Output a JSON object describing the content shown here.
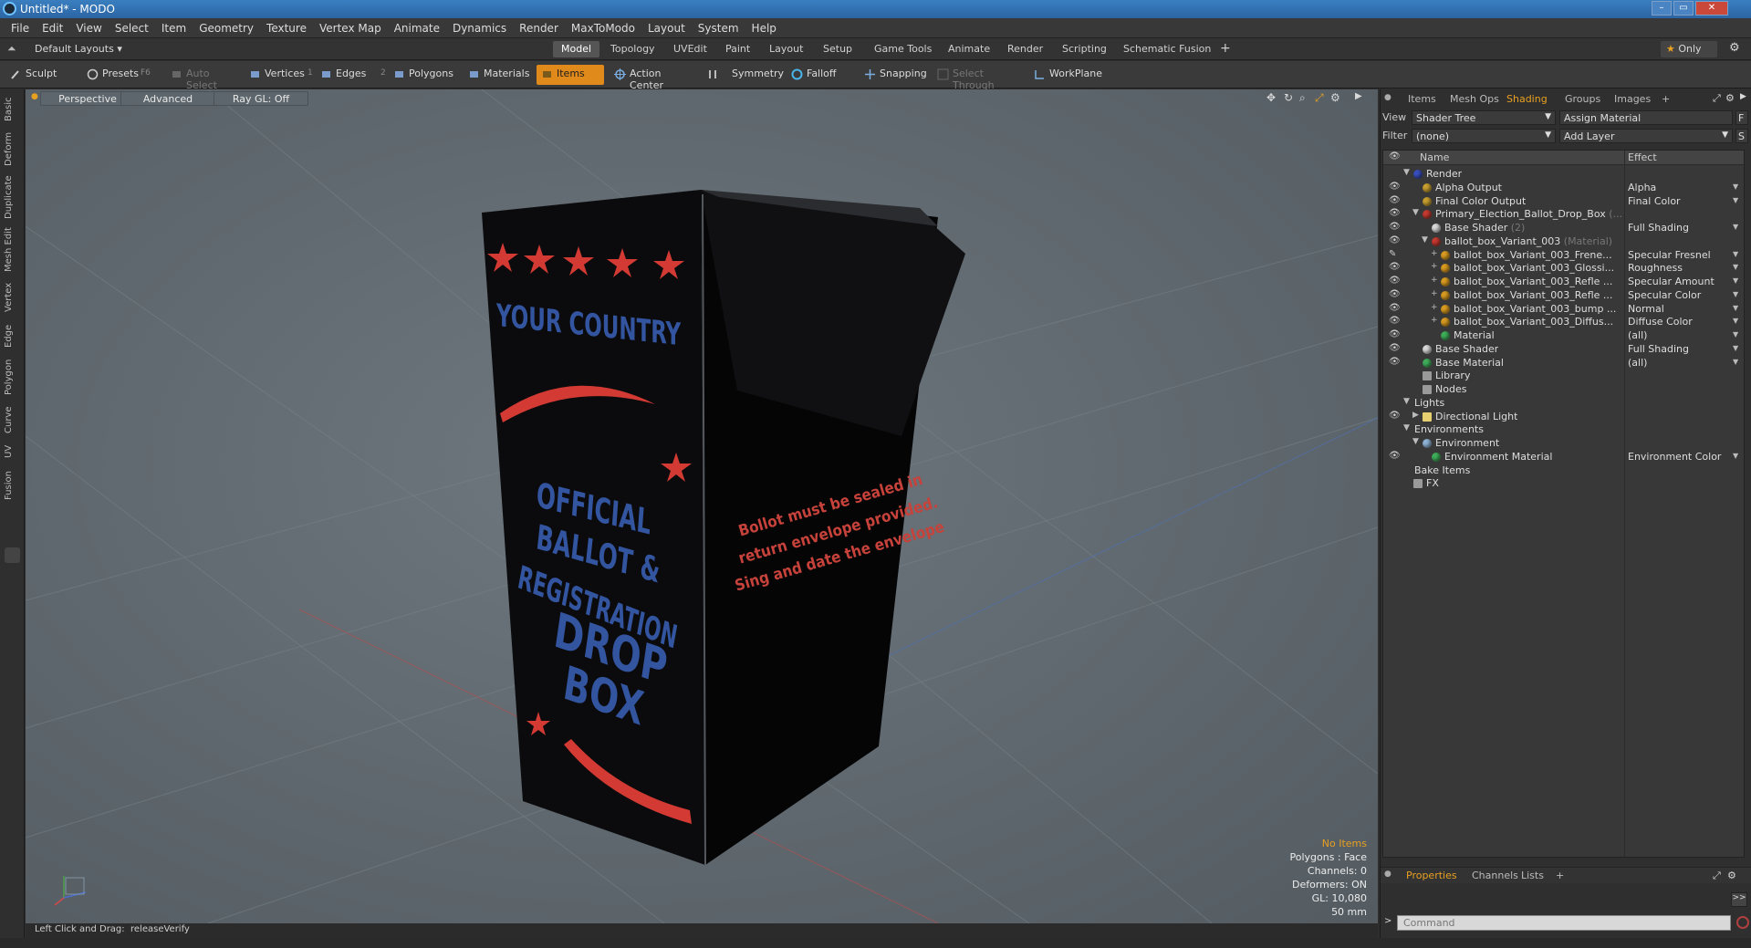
{
  "window": {
    "title": "Untitled* - MODO"
  },
  "menu": [
    "File",
    "Edit",
    "View",
    "Select",
    "Item",
    "Geometry",
    "Texture",
    "Vertex Map",
    "Animate",
    "Dynamics",
    "Render",
    "MaxToModo",
    "Layout",
    "System",
    "Help"
  ],
  "layout": {
    "current": "Default Layouts",
    "tabs": [
      "Model",
      "Topology",
      "UVEdit",
      "Paint",
      "Layout",
      "Setup",
      "Game Tools",
      "Animate",
      "Render",
      "Scripting",
      "Schematic Fusion"
    ],
    "active_tab": "Model",
    "add": "+",
    "only_label": "Only"
  },
  "toolbar": {
    "sculpt": "Sculpt",
    "presets": "Presets",
    "presets_key": "F6",
    "auto_select": "Auto Select",
    "vertices": "Vertices",
    "vertices_key": "1",
    "edges": "Edges",
    "edges_key": "2",
    "polygons": "Polygons",
    "materials": "Materials",
    "items": "Items",
    "action_center": "Action Center",
    "symmetry": "Symmetry",
    "falloff": "Falloff",
    "snapping": "Snapping",
    "select_through": "Select Through",
    "workplane": "WorkPlane"
  },
  "left_tabs": [
    "Basic",
    "Deform",
    "Duplicate",
    "Mesh Edit",
    "Vertex",
    "Edge",
    "Polygon",
    "Curve",
    "UV",
    "Fusion"
  ],
  "viewport": {
    "view": "Perspective",
    "shading": "Advanced",
    "raygl": "Ray GL: Off",
    "hud": {
      "items": "No Items",
      "polygons": "Polygons : Face",
      "channels": "Channels: 0",
      "deformers": "Deformers: ON",
      "gl": "GL: 10,080",
      "distance": "50 mm"
    },
    "model_text": {
      "country": "YOUR COUNTRY",
      "official": "OFFICIAL",
      "ballot": "BALLOT &",
      "registration": "REGISTRATION",
      "drop": "DROP",
      "box": "BOX",
      "instr1": "Bollot must be sealed in",
      "instr2": "return envelope provided.",
      "instr3": "Sing and date the envelope"
    }
  },
  "status": {
    "hint": "Left Click and Drag:",
    "action": "releaseVerify"
  },
  "panel": {
    "tabs": [
      "Items",
      "Mesh Ops",
      "Shading",
      "Groups",
      "Images"
    ],
    "active_tab": "Shading",
    "add": "+",
    "view_label": "View",
    "view_value": "Shader Tree",
    "assign_material": "Assign Material",
    "assign_key": "F",
    "filter_label": "Filter",
    "filter_value": "(none)",
    "add_layer": "Add Layer",
    "add_layer_key": "S",
    "columns": {
      "name": "Name",
      "effect": "Effect"
    },
    "tree": [
      {
        "name": "Render",
        "effect": "",
        "depth": 0,
        "eye": false,
        "arrow": "▼",
        "icon": "#3a4fbf"
      },
      {
        "name": "Alpha Output",
        "effect": "Alpha",
        "depth": 1,
        "eye": true,
        "arrow": "",
        "icon": "#c8a030"
      },
      {
        "name": "Final Color Output",
        "effect": "Final Color",
        "depth": 1,
        "eye": true,
        "arrow": "",
        "icon": "#c8a030"
      },
      {
        "name": "Primary_Election_Ballot_Drop_Box",
        "suffix": "(...",
        "effect": "",
        "depth": 1,
        "eye": true,
        "arrow": "▼",
        "icon": "#c53a30"
      },
      {
        "name": "Base Shader",
        "suffix": "(2)",
        "effect": "Full Shading",
        "depth": 2,
        "eye": true,
        "arrow": "",
        "icon": "#d8d8d8"
      },
      {
        "name": "ballot_box_Variant_003",
        "suffix": "(Material)",
        "effect": "",
        "depth": 2,
        "eye": true,
        "arrow": "▼",
        "icon": "#c53a30"
      },
      {
        "name": "ballot_box_Variant_003_Frene...",
        "effect": "Specular Fresnel",
        "depth": 3,
        "eye": false,
        "brush": true,
        "arrow": "+",
        "icon": "#d89a20"
      },
      {
        "name": "ballot_box_Variant_003_Glossi...",
        "effect": "Roughness",
        "depth": 3,
        "eye": true,
        "arrow": "+",
        "icon": "#d89a20"
      },
      {
        "name": "ballot_box_Variant_003_Refle ...",
        "effect": "Specular Amount",
        "depth": 3,
        "eye": true,
        "arrow": "+",
        "icon": "#d89a20"
      },
      {
        "name": "ballot_box_Variant_003_Refle ...",
        "effect": "Specular Color",
        "depth": 3,
        "eye": true,
        "arrow": "+",
        "icon": "#d89a20"
      },
      {
        "name": "ballot_box_Variant_003_bump ...",
        "effect": "Normal",
        "depth": 3,
        "eye": true,
        "arrow": "+",
        "icon": "#d89a20"
      },
      {
        "name": "ballot_box_Variant_003_Diffus...",
        "effect": "Diffuse Color",
        "depth": 3,
        "eye": true,
        "arrow": "+",
        "icon": "#d89a20"
      },
      {
        "name": "Material",
        "effect": "(all)",
        "depth": 3,
        "eye": true,
        "arrow": "",
        "icon": "#3fae5a"
      },
      {
        "name": "Base Shader",
        "effect": "Full Shading",
        "depth": 1,
        "eye": true,
        "arrow": "",
        "icon": "#d8d8d8"
      },
      {
        "name": "Base Material",
        "effect": "(all)",
        "depth": 1,
        "eye": true,
        "arrow": "",
        "icon": "#3fae5a"
      },
      {
        "name": "Library",
        "effect": "",
        "depth": 1,
        "eye": false,
        "arrow": "",
        "icon": "folder"
      },
      {
        "name": "Nodes",
        "effect": "",
        "depth": 1,
        "eye": false,
        "arrow": "",
        "icon": "folder"
      },
      {
        "name": "Lights",
        "effect": "",
        "depth": 0,
        "eye": false,
        "arrow": "▼",
        "icon": "none"
      },
      {
        "name": "Directional Light",
        "effect": "",
        "depth": 1,
        "eye": true,
        "arrow": "▶",
        "icon": "light"
      },
      {
        "name": "Environments",
        "effect": "",
        "depth": 0,
        "eye": false,
        "arrow": "▼",
        "icon": "none"
      },
      {
        "name": "Environment",
        "effect": "",
        "depth": 1,
        "eye": false,
        "arrow": "▼",
        "icon": "#8fb4d8"
      },
      {
        "name": "Environment Material",
        "effect": "Environment Color",
        "depth": 2,
        "eye": true,
        "arrow": "",
        "icon": "#3fae5a"
      },
      {
        "name": "Bake Items",
        "effect": "",
        "depth": 0,
        "eye": false,
        "arrow": "",
        "icon": "none"
      },
      {
        "name": "FX",
        "effect": "",
        "depth": 0,
        "eye": false,
        "arrow": "",
        "icon": "fx"
      }
    ],
    "bottom_tabs": [
      "Properties",
      "Channels",
      "Lists"
    ],
    "bottom_active": "Properties",
    "command_placeholder": "Command"
  },
  "colors": {
    "accent": "#e8a020",
    "items_active": "#e08a1c",
    "box_blue": "#3355a0",
    "box_red": "#d43a34"
  }
}
